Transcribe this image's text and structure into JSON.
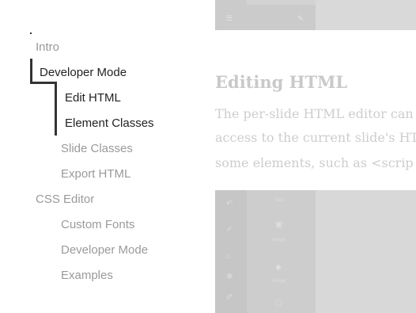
{
  "toc": {
    "items": [
      {
        "label": "Intro",
        "active": false
      },
      {
        "label": "Developer Mode",
        "active": true
      },
      {
        "label": "Edit HTML",
        "active": true
      },
      {
        "label": "Element Classes",
        "active": true
      },
      {
        "label": "Slide Classes",
        "active": false
      },
      {
        "label": "Export HTML",
        "active": false
      },
      {
        "label": "CSS Editor",
        "active": false
      },
      {
        "label": "Custom Fonts",
        "active": false
      },
      {
        "label": "Developer Mode",
        "active": false
      },
      {
        "label": "Examples",
        "active": false
      }
    ]
  },
  "content": {
    "title": "Editing HTML",
    "paragraph_lines": [
      "The per-slide HTML editor can",
      "access to the current slide's HT",
      "some elements, such as <scrip"
    ],
    "editor_shot": {
      "captions": [
        "Text",
        "Image",
        "Shape"
      ]
    }
  }
}
